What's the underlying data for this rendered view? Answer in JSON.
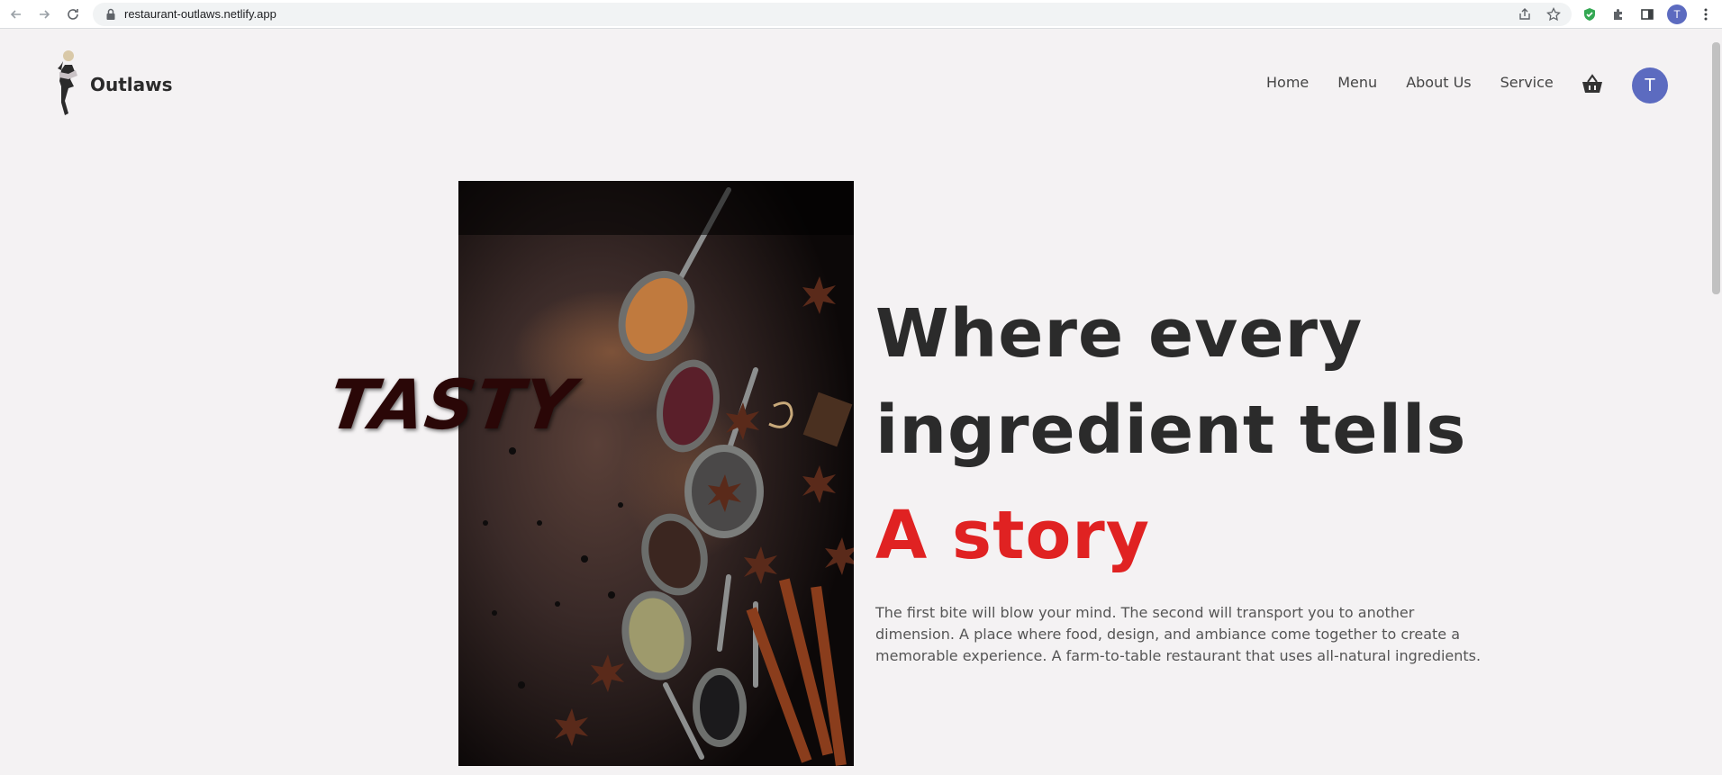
{
  "browser": {
    "url": "restaurant-outlaws.netlify.app",
    "profile_initial": "T",
    "icons": [
      "back-icon",
      "forward-icon",
      "reload-icon",
      "lock-icon",
      "share-icon",
      "star-icon",
      "shield-extension-icon",
      "puzzle-icon",
      "side-panel-icon",
      "menu-dots-icon"
    ]
  },
  "site": {
    "brand": "Outlaws",
    "nav": [
      "Home",
      "Menu",
      "About Us",
      "Service"
    ],
    "user_initial": "T"
  },
  "hero": {
    "overlay_word": "TASTY",
    "headline_line1": "Where every",
    "headline_line2": "ingredient tells",
    "headline_accent": "A story",
    "description": "The first bite will blow your mind. The second will transport you to another dimension. A place where food, design, and ambiance come together to create a memorable experience. A farm-to-table restaurant that uses all-natural ingredients."
  },
  "colors": {
    "accent": "#e02222",
    "avatar": "#5c6bc0",
    "page_bg": "#f4f2f3",
    "heading": "#2b2b2b"
  }
}
